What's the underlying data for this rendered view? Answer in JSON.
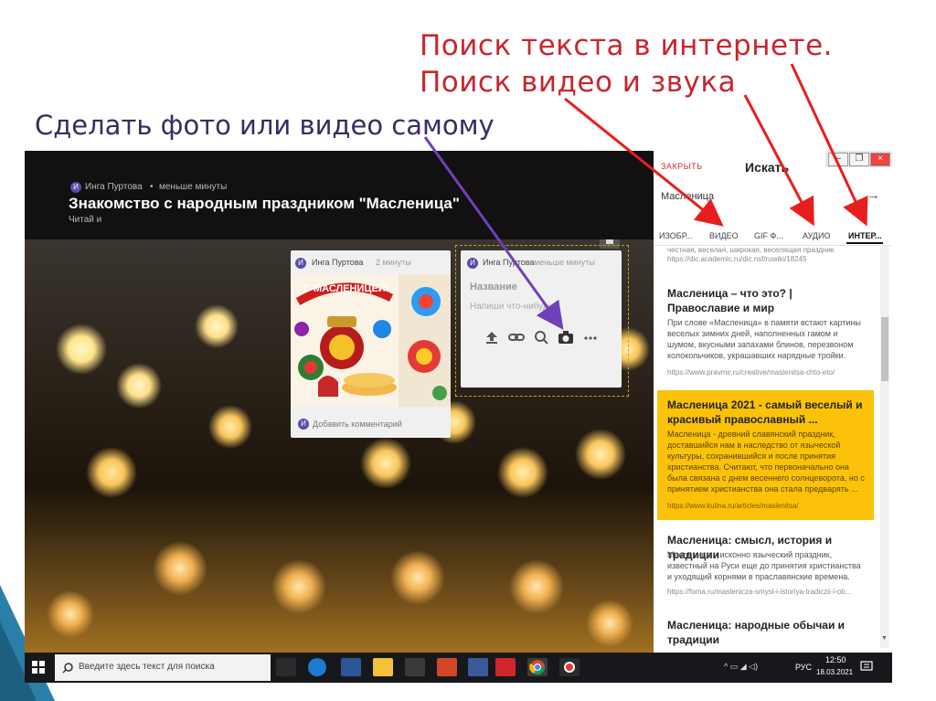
{
  "slide": {
    "title_line1": "Поиск текста в интернете.",
    "title_line2": "Поиск видео   и    звука",
    "subtitle": "Сделать фото или видео самому",
    "colors": {
      "title": "#c8262e",
      "subtitle": "#3b2a63",
      "arrow_red": "#e81e1e",
      "arrow_purple": "#7040b8"
    }
  },
  "padlet": {
    "author": "Инга Пуртова",
    "time": "меньше минуты",
    "board_title": "Знакомство с народным праздником \"Масленица\"",
    "board_desc": "Читай и",
    "avatar_letter": "И",
    "post1": {
      "author": "Инга Пуртова",
      "time": "2 минуты",
      "image_text": "С МАСЛЕНИЦЕЙ!",
      "comment_placeholder": "Добавить комментарий"
    },
    "post2": {
      "author": "Инга Пуртова",
      "time": "меньше минуты",
      "title_placeholder": "Название",
      "body_placeholder": "Напиши что-нибудь",
      "tool_icons": [
        "upload-icon",
        "link-icon",
        "search-icon",
        "camera-icon",
        "more-icon"
      ]
    }
  },
  "search_panel": {
    "close_label": "ЗАКРЫТЬ",
    "title": "Искать",
    "query": "Масленица",
    "tabs": [
      "ИЗОБР...",
      "ВИДЕО",
      "GIF Ф...",
      "АУДИО",
      "ИНТЕР..."
    ],
    "top_snippet": "честная, веселая, широкая, веселящая праздник",
    "top_url": "https://dic.academic.ru/dic.nsf/ruwiki/18245",
    "results": [
      {
        "title": "Масленица – что это? | Православие и мир",
        "snippet": "При слове «Масленица» в памяти встают картины веселых зимних дней, наполненных гамом и шумом, вкусными запахами блинов, перезвоном колокольчиков, украшавших нарядные тройки.",
        "url": "https://www.pravmir.ru/creative/maslenitsa-chto-eto/"
      },
      {
        "title": "Масленица 2021 - самый веселый и красивый православный ...",
        "snippet": "Масленица - древний славянский праздник, доставшийся нам в наследство от языческой культуры, сохранившийся и после принятия христианства. Считают, что первоначально она была связана с днем весеннего солнцеворота, но с принятием христианства она стала предварять ...",
        "url": "https://www.kulina.ru/articles/maslenitsa/"
      },
      {
        "title": "Масленица: смысл, история и традиции",
        "snippet": "Масленица – исконно языческий праздник, известный на Руси еще до принятия христианства и уходящий корнями в праславянские времена.",
        "url": "https://foma.ru/maslenicza-smysl-i-istoriya-tradiczii-i-ob..."
      },
      {
        "title": "Масленица: народные обычаи и традиции",
        "snippet": "",
        "url": ""
      }
    ],
    "highlight_color": "#fcc20a"
  },
  "taskbar": {
    "search_placeholder": "Введите здесь текст для поиска",
    "time": "12:50",
    "date": "18.03.2021",
    "lang": "РУС"
  }
}
